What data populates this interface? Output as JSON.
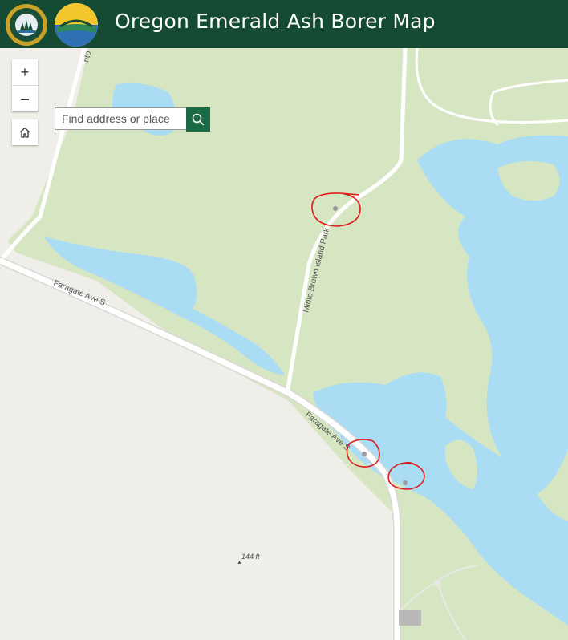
{
  "header": {
    "title": "Oregon Emerald Ash Borer Map",
    "seal_text_top": "OREGON",
    "seal_text_bottom": "DEPARTMENT OF FORESTRY",
    "colors": {
      "background": "#154a33",
      "title": "#ffffff"
    }
  },
  "search": {
    "placeholder": "Find address or place",
    "button_icon": "search-icon"
  },
  "controls": {
    "zoom_in": "+",
    "zoom_out": "–",
    "home_icon": "home-icon"
  },
  "map": {
    "labels": {
      "road_1": "Faragate Ave S",
      "road_2": "Faragate Ave S",
      "road_3": "Minto Brown Island Park",
      "road_4": "nto",
      "elevation": "144 ft"
    },
    "colors": {
      "park": "#d7e6c2",
      "water": "#aadcf4",
      "land": "#efeee9",
      "road": "#ffffff",
      "annotation": "#e01b1b"
    }
  }
}
